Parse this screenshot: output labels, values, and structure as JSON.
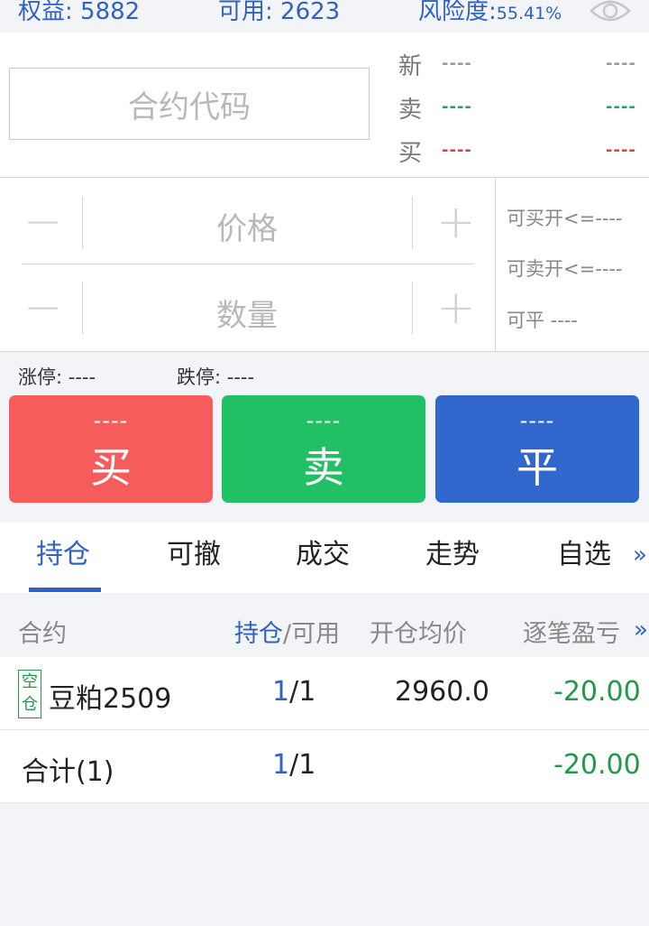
{
  "account": {
    "equity_label": "权益:",
    "equity_value": "5882",
    "available_label": "可用:",
    "available_value": "2623",
    "risk_label": "风险度:",
    "risk_value": "55.41%"
  },
  "order": {
    "code_placeholder": "合约代码",
    "quote": [
      {
        "label": "新",
        "left": "----",
        "right": "----",
        "color": "#999999"
      },
      {
        "label": "卖",
        "left": "----",
        "right": "----",
        "color": "#1fa84f"
      },
      {
        "label": "买",
        "left": "----",
        "right": "----",
        "color": "#e04040"
      }
    ],
    "price_placeholder": "价格",
    "quantity_placeholder": "数量",
    "minus": "−",
    "plus": "+",
    "can_buy_open": "可买开<=----",
    "can_sell_open": "可卖开<=----",
    "can_close": "可平  ----",
    "limit_up": "涨停: ----",
    "limit_down": "跌停: ----"
  },
  "buttons": [
    {
      "price": "----",
      "label": "买",
      "color": "#f65c5c"
    },
    {
      "price": "----",
      "label": "卖",
      "color": "#21c065"
    },
    {
      "price": "----",
      "label": "平",
      "color": "#3267ce"
    }
  ],
  "tabs": [
    "持仓",
    "可撤",
    "成交",
    "走势",
    "自选"
  ],
  "tabs_more": "»",
  "table": {
    "headers": {
      "contract": "合约",
      "position_a": "持仓",
      "position_b": "/可用",
      "avg_price": "开仓均价",
      "pnl": "逐笔盈亏",
      "more": "»"
    },
    "rows": [
      {
        "tag": [
          "空",
          "仓"
        ],
        "contract": "豆粕2509",
        "pos": "1",
        "avail": "/1",
        "avg": "2960.0",
        "pnl": "-20.00"
      }
    ],
    "total": {
      "label": "合计(1)",
      "pos": "1",
      "avail": "/1",
      "pnl": "-20.00"
    }
  }
}
